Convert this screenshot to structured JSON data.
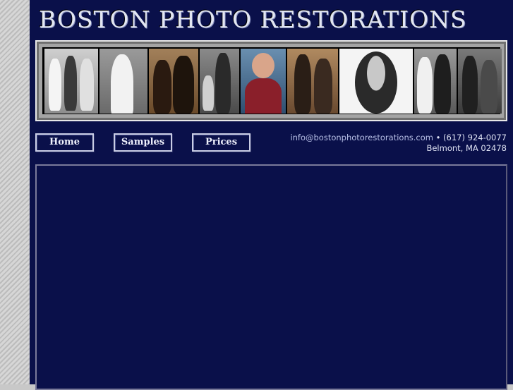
{
  "site": {
    "title": "BOSTON PHOTO RESTORATIONS"
  },
  "nav": [
    {
      "label": "Home"
    },
    {
      "label": "Samples"
    },
    {
      "label": "Prices"
    }
  ],
  "contact": {
    "email": "info@bostonphotorestorations.com",
    "separator": "•",
    "phone": "(617) 924-0077",
    "address": "Belmont, MA 02478"
  },
  "banner": {
    "photos": [
      {
        "name": "three-women-photo",
        "tone": "#9a9a9a"
      },
      {
        "name": "bride-photo",
        "tone": "#bdbdbd"
      },
      {
        "name": "couple-sepia-photo",
        "tone": "#7a5a3a"
      },
      {
        "name": "father-children-photo",
        "tone": "#6e6e6e"
      },
      {
        "name": "colorized-woman-photo",
        "tone": "#4a6f8f"
      },
      {
        "name": "couple-standing-photo",
        "tone": "#8a6a4a"
      },
      {
        "name": "oval-portrait-photo",
        "tone": "#e8e8e8"
      },
      {
        "name": "wedding-couple-photo",
        "tone": "#7a7a7a"
      },
      {
        "name": "seated-couple-photo",
        "tone": "#5a5a5a"
      }
    ]
  }
}
